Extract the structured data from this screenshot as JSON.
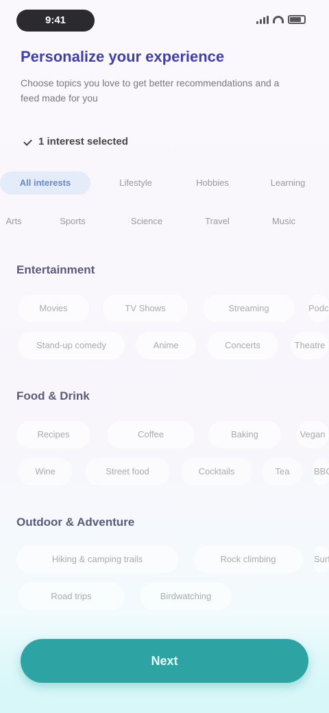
{
  "status": {
    "time": "9:41"
  },
  "header": {
    "title": "Personalize your experience",
    "subtitle": "Choose topics you love to get better recommendations and a feed made for you"
  },
  "selected_summary": "1 interest selected",
  "tabs_row1": [
    "All interests",
    "Lifestyle",
    "Hobbies",
    "Learning"
  ],
  "tabs_row2": [
    "Arts",
    "Sports",
    "Science",
    "Travel",
    "Music"
  ],
  "sections": [
    {
      "title": "Entertainment",
      "rows": [
        [
          "Movies",
          "TV Shows",
          "Streaming",
          "Podcasts"
        ],
        [
          "Stand-up comedy",
          "Anime",
          "Concerts",
          "Theatre"
        ]
      ]
    },
    {
      "title": "Food & Drink",
      "rows": [
        [
          "Recipes",
          "Coffee",
          "Baking",
          "Vegan"
        ],
        [
          "Wine",
          "Street food",
          "Cocktails",
          "Tea",
          "BBQ"
        ]
      ]
    },
    {
      "title": "Outdoor & Adventure",
      "rows": [
        [
          "Hiking & camping trails",
          "Rock climbing",
          "Surfing"
        ],
        [
          "Road trips",
          "Birdwatching"
        ]
      ]
    }
  ],
  "button": {
    "label": "Next"
  },
  "colors": {
    "accent": "#2ea3a3",
    "title": "#3f3fa8",
    "active_tab_bg": "#e3ecf8"
  }
}
